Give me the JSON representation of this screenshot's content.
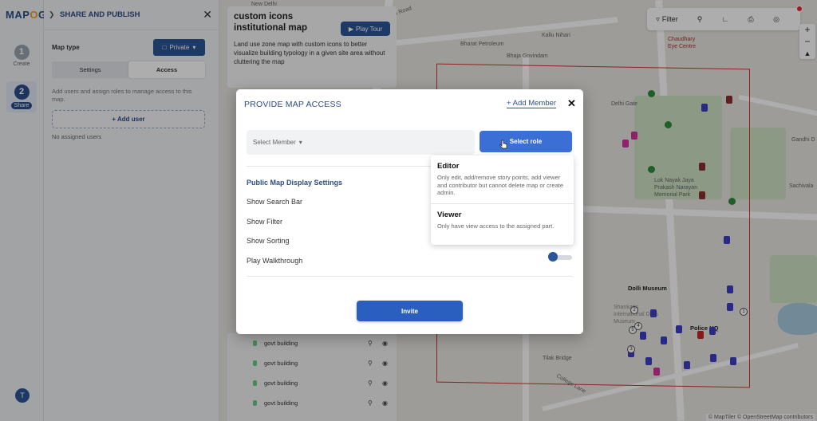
{
  "app": {
    "logo_text": "MAPOG",
    "steps": [
      {
        "num": "1",
        "label": "Create"
      },
      {
        "num": "2",
        "label": "Share"
      }
    ],
    "avatar_initial": "T"
  },
  "share_panel": {
    "title": "SHARE AND PUBLISH",
    "map_type_label": "Map type",
    "map_type_value": "Private",
    "tabs": [
      "Settings",
      "Access"
    ],
    "active_tab": "Access",
    "description": "Add users and assign roles to manage access to this map.",
    "add_user_label": "+ Add user",
    "no_users_text": "No assigned users"
  },
  "map_card": {
    "title": "custom icons institutional map",
    "play_tour_label": "Play Tour",
    "description": "Land use zone map with custom icons to better visualize building typology in a given site area without cluttering the map"
  },
  "layers": [
    {
      "name": "govt building"
    },
    {
      "name": "govt building"
    },
    {
      "name": "govt building"
    },
    {
      "name": "govt building"
    }
  ],
  "toolbar": {
    "filter_label": "Filter"
  },
  "map_labels": {
    "new_delhi": "New Delhi",
    "asaf_ali": "Asaf Ali Road",
    "bharat_petroleum": "Bharat Petroleum",
    "bhaja_govindam": "Bhaja Govindam",
    "kallu_nihari": "Kallu Nihari",
    "chaudhary_eye": "Chaudhary Eye Centre",
    "delhi_gate": "Delhi Gate",
    "gandhi_d": "Gandhi D",
    "lok_nayak": "Lok Nayak Jaya Prakash Narayan Memorial Park",
    "sachivala": "Sachivala",
    "dolli_museum": "Dolli Museum",
    "shankar_intl": "Shankar's International Dolls Museum",
    "police_hq": "Police HQ",
    "tilak_bridge": "Tilak Bridge",
    "college_lane": "College Lane",
    "attribution": "© MapTiler © OpenStreetMap contributors"
  },
  "modal": {
    "title": "PROVIDE MAP ACCESS",
    "add_member_label": "+ Add Member",
    "select_member_placeholder": "Select Member",
    "select_role_label": "Select role",
    "settings_title": "Public Map Display Settings",
    "settings": [
      {
        "label": "Show Search Bar"
      },
      {
        "label": "Show Filter"
      },
      {
        "label": "Show Sorting"
      },
      {
        "label": "Play Walkthrough",
        "enabled": false
      }
    ],
    "invite_label": "Invite"
  },
  "roles": [
    {
      "name": "Editor",
      "description": "Only edit, add/remove story points, add viewer and contributor but cannot delete map or create admin."
    },
    {
      "name": "Viewer",
      "description": "Only have view access to the assigned part."
    }
  ],
  "colors": {
    "primary": "#2b5597",
    "accent_button": "#3c6fd6",
    "boundary": "#d0342c"
  }
}
